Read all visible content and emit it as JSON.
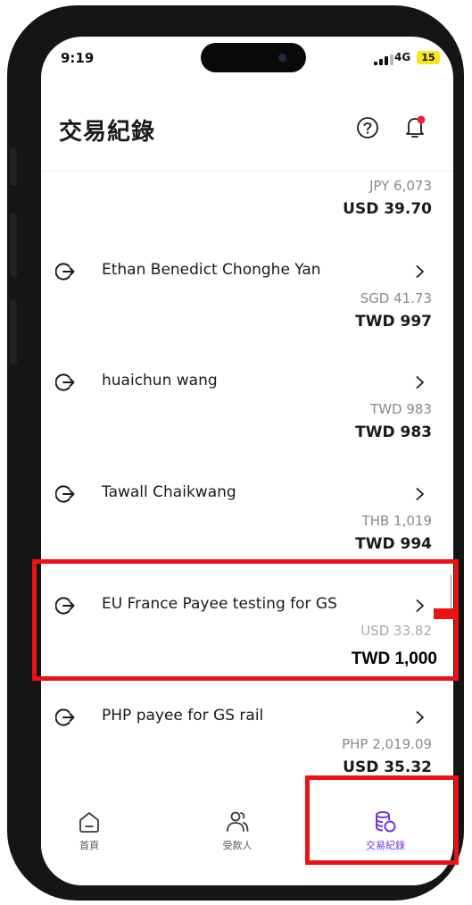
{
  "status_bar": {
    "time": "9:19",
    "network": "4G",
    "battery": "15"
  },
  "header": {
    "title": "交易紀錄",
    "help_icon": "question-circle-icon",
    "notification_icon": "bell-with-dot-icon"
  },
  "partial_top": {
    "foreign_amount": "JPY 6,073",
    "amount": "USD 39.70"
  },
  "transactions": [
    {
      "name": "Ethan Benedict Chonghe Yan",
      "foreign_amount": "SGD 41.73",
      "amount": "TWD 997"
    },
    {
      "name": "huaichun wang",
      "foreign_amount": "TWD 983",
      "amount": "TWD 983"
    },
    {
      "name": "Tawall Chaikwang",
      "foreign_amount": "THB 1,019",
      "amount": "TWD 994"
    },
    {
      "name": "EU France Payee testing for GS",
      "foreign_amount": "USD 33.82",
      "amount": "TWD 1,000"
    },
    {
      "name": "PHP payee for GS rail",
      "foreign_amount": "PHP 2,019.09",
      "amount": "USD 35.32"
    }
  ],
  "nav": [
    {
      "label": "首頁",
      "icon": "home-icon",
      "active": false
    },
    {
      "label": "受款人",
      "icon": "people-icon",
      "active": false
    },
    {
      "label": "交易紀錄",
      "icon": "coins-icon",
      "active": true
    }
  ],
  "colors": {
    "accent": "#7a35d8",
    "highlight": "#ee1111",
    "notification_dot": "#e3263b",
    "battery": "#f6e61f"
  }
}
